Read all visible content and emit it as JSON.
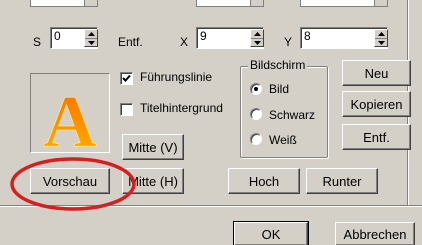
{
  "spin_row": {
    "s_label": "S",
    "s_value": "0",
    "entf_label": "Entf.",
    "x_label": "X",
    "x_value": "9",
    "y_label": "Y",
    "y_value": "8"
  },
  "preview": {
    "letter": "A",
    "letter_color_top": "#ff6a00",
    "letter_color_bottom": "#ffb400"
  },
  "checkboxes": {
    "fuehrungslinie": {
      "label": "Führungslinie",
      "checked": true
    },
    "titelhintergrund": {
      "label": "Titelhintergrund",
      "checked": false
    }
  },
  "bildschirm": {
    "title": "Bildschirm",
    "options": [
      {
        "label": "Bild",
        "selected": true
      },
      {
        "label": "Schwarz",
        "selected": false
      },
      {
        "label": "Weiß",
        "selected": false
      }
    ]
  },
  "buttons": {
    "neu": "Neu",
    "kopieren": "Kopieren",
    "entf": "Entf.",
    "mitte_v": "Mitte (V)",
    "mitte_h": "Mitte (H)",
    "vorschau": "Vorschau",
    "hoch": "Hoch",
    "runter": "Runter",
    "ok": "OK",
    "abbrechen": "Abbrechen"
  },
  "annotation_color": "#d42020"
}
